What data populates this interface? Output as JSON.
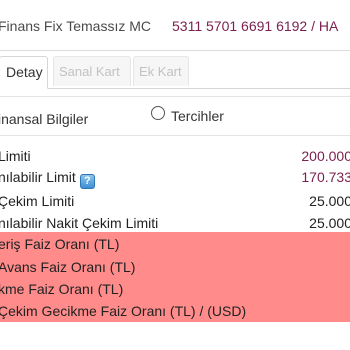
{
  "header": {
    "card_name": "Finans Fix Temassız MC",
    "card_number": "5311 5701 6691 6192  /   HA"
  },
  "tabs": [
    {
      "label": "Detay",
      "state": "active"
    },
    {
      "label": "Sanal Kart",
      "state": "disabled"
    },
    {
      "label": "Ek Kart",
      "state": "disabled"
    }
  ],
  "subheader": {
    "left_label": "inansal Bilgiler",
    "radio_label": "Tercihler"
  },
  "rows": [
    {
      "label": "Limiti",
      "value": "200.000"
    },
    {
      "label": "nılabilir Limit",
      "value": "170.733"
    },
    {
      "label": " Çekim Limiti",
      "value": "25.000"
    },
    {
      "label": "nılabilir Nakit Çekim Limiti",
      "value": "25.000"
    }
  ],
  "pink_rows": [
    {
      "label": "eriş Faiz Oranı (TL)"
    },
    {
      "label": " Avans Faiz Oranı (TL)"
    },
    {
      "label": "kme Faiz Oranı (TL)"
    },
    {
      "label": " Çekim Gecikme Faiz Oranı (TL) / (USD)"
    }
  ],
  "help_icon_glyph": "?",
  "colors": {
    "accent_purple": "#7a1f4e",
    "highlight_pink": "#ff8b8b",
    "help_icon_blue": "#3c8fd4"
  }
}
